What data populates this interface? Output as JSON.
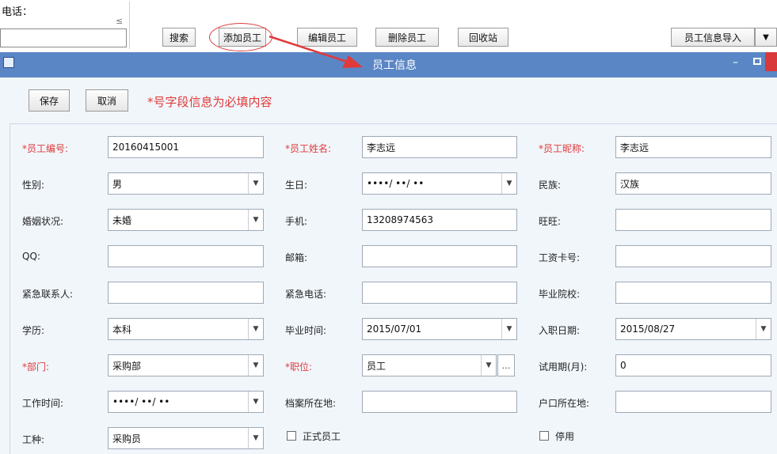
{
  "toolbar": {
    "phone_label": "电话：",
    "phone_value": "",
    "phone_hint": "≤",
    "search": "搜索",
    "add": "添加员工",
    "edit": "编辑员工",
    "delete": "删除员工",
    "recycle": "回收站",
    "import": "员工信息导入",
    "import_arrow": "▼"
  },
  "dialog": {
    "title": "员工信息",
    "min_glyph": "–",
    "save": "保存",
    "cancel": "取消",
    "note": "*号字段信息为必填内容"
  },
  "form": {
    "emp_no": {
      "label": "*员工编号:",
      "value": "20160415001"
    },
    "emp_name": {
      "label": "*员工姓名:",
      "value": "李志远"
    },
    "emp_nick": {
      "label": "*员工昵称:",
      "value": "李志远"
    },
    "gender": {
      "label": "性别:",
      "value": "男"
    },
    "birthday": {
      "label": "生日:",
      "value": "••••/ ••/ ••"
    },
    "nation": {
      "label": "民族:",
      "value": "汉族"
    },
    "marital": {
      "label": "婚姻状况:",
      "value": "未婚"
    },
    "mobile": {
      "label": "手机:",
      "value": "13208974563"
    },
    "wangwang": {
      "label": "旺旺:",
      "value": ""
    },
    "qq": {
      "label": "QQ:",
      "value": ""
    },
    "email": {
      "label": "邮箱:",
      "value": ""
    },
    "salary_card": {
      "label": "工资卡号:",
      "value": ""
    },
    "emergency_contact": {
      "label": "紧急联系人:",
      "value": ""
    },
    "emergency_phone": {
      "label": "紧急电话:",
      "value": ""
    },
    "school": {
      "label": "毕业院校:",
      "value": ""
    },
    "education": {
      "label": "学历:",
      "value": "本科"
    },
    "grad_date": {
      "label": "毕业时间:",
      "value": "2015/07/01"
    },
    "hire_date": {
      "label": "入职日期:",
      "value": "2015/08/27"
    },
    "department": {
      "label": "*部门:",
      "value": "采购部"
    },
    "position": {
      "label": "*职位:",
      "value": "员工"
    },
    "probation": {
      "label": "试用期(月):",
      "value": "0"
    },
    "work_time": {
      "label": "工作时间:",
      "value": "••••/ ••/ ••"
    },
    "archive_place": {
      "label": "档案所在地:",
      "value": ""
    },
    "hukou_place": {
      "label": "户口所在地:",
      "value": ""
    },
    "job_type": {
      "label": "工种:",
      "value": "采购员"
    },
    "formal_staff": {
      "label": "正式员工",
      "checked": false
    },
    "disabled": {
      "label": "停用",
      "checked": false
    }
  },
  "colors": {
    "titlebar": "#5a86c6",
    "required": "#e03a3a",
    "annotation": "#e03a3a",
    "close": "#d9393a"
  }
}
